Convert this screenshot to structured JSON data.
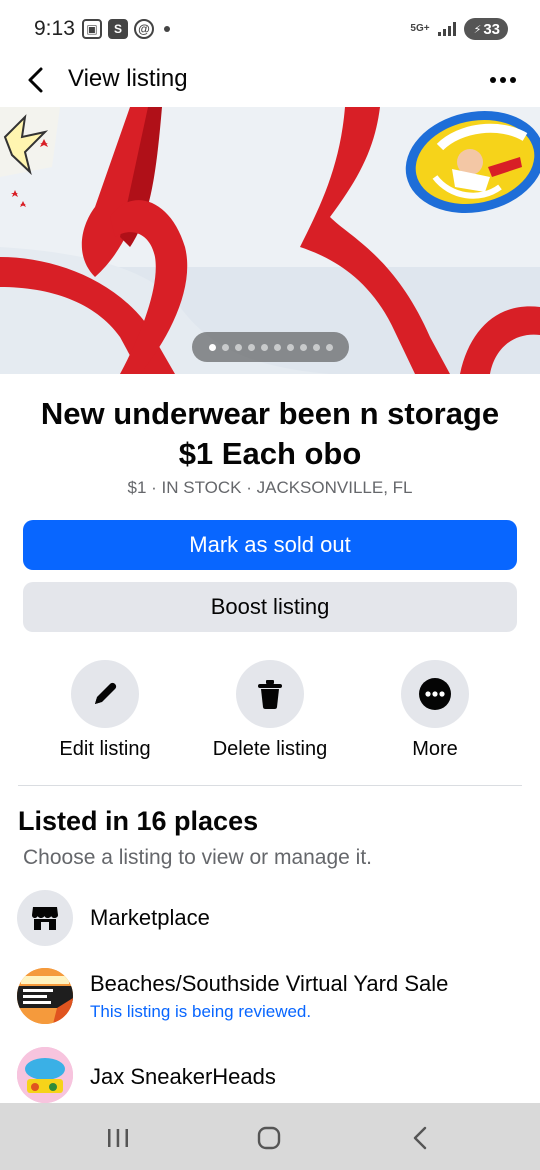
{
  "status_bar": {
    "time": "9:13",
    "network": "5G+",
    "battery": "33"
  },
  "header": {
    "back_icon": "arrow-left-icon",
    "title": "View listing",
    "more_icon": "more-horizontal-icon"
  },
  "hero": {
    "image_description_icon": "photo",
    "page_count": 10,
    "current_page": 1,
    "colors": {
      "fabric": "#eef2f6",
      "trim": "#d81f26"
    }
  },
  "listing": {
    "title": "New underwear been n storage $1 Each obo",
    "meta": "$1 · IN STOCK · JACKSONVILLE, FL"
  },
  "buttons": {
    "mark_sold": "Mark as sold out",
    "boost": "Boost listing"
  },
  "actions": [
    {
      "label": "Edit listing",
      "icon": "pencil-icon"
    },
    {
      "label": "Delete listing",
      "icon": "trash-icon"
    },
    {
      "label": "More",
      "icon": "more-horizontal-icon"
    }
  ],
  "listed": {
    "title": "Listed in 16 places",
    "subtitle": "Choose a listing to view or manage it.",
    "places": [
      {
        "name": "Marketplace",
        "icon": "storefront-icon"
      },
      {
        "name": "Beaches/Southside Virtual Yard Sale",
        "note": "This listing is being reviewed.",
        "icon": "group-avatar"
      },
      {
        "name": "Jax SneakerHeads",
        "icon": "group-avatar"
      }
    ]
  },
  "nav": {
    "recents": "recents-icon",
    "home": "home-icon",
    "back": "back-icon"
  },
  "colors": {
    "primary": "#0866ff",
    "secondary_bg": "#e4e6eb",
    "text": "#050505",
    "muted": "#65676b"
  }
}
